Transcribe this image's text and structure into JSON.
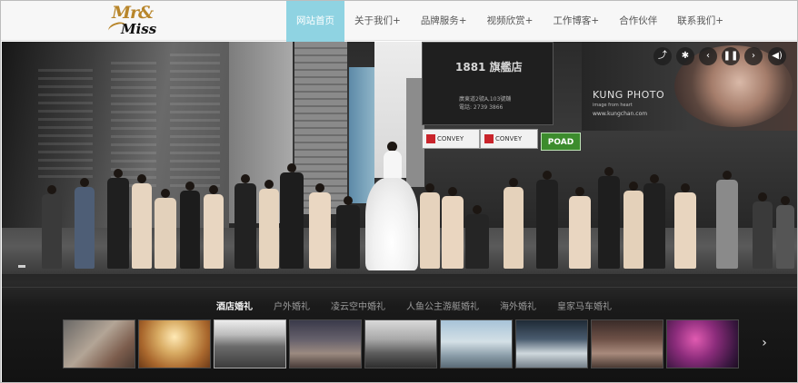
{
  "brand": {
    "logo_line1": "Mr&",
    "logo_line2": "Miss"
  },
  "nav": [
    {
      "label": "网站首页",
      "active": true
    },
    {
      "label": "关于我们+"
    },
    {
      "label": "品牌服务+"
    },
    {
      "label": "视频欣赏+"
    },
    {
      "label": "工作博客+"
    },
    {
      "label": "合作伙伴"
    },
    {
      "label": "联系我们+"
    }
  ],
  "hero": {
    "signs": {
      "sign_1881": "1881 旗艦店",
      "sign_1881_addr": "廣東道2號A,103號舖",
      "sign_1881_tel": "電話: 2739 3866",
      "kung_title": "KUNG PHOTO",
      "kung_tagline": "image from heart",
      "kung_url": "www.kungchan.com",
      "convey": "CONVEY",
      "poad": "POAD"
    },
    "controls": {
      "share_icon": "share-icon",
      "brightness_icon": "brightness-icon",
      "prev_icon": "prev-icon",
      "pause_icon": "pause-icon",
      "next_icon": "next-icon",
      "volume_icon": "volume-icon"
    }
  },
  "gallery": {
    "categories": [
      {
        "label": "酒店婚礼",
        "active": true
      },
      {
        "label": "户外婚礼"
      },
      {
        "label": "凌云空中婚礼"
      },
      {
        "label": "人鱼公主游艇婚礼"
      },
      {
        "label": "海外婚礼"
      },
      {
        "label": "皇家马车婚礼"
      }
    ],
    "thumb_count": 9,
    "next_glyph": "›"
  },
  "colors": {
    "nav_active": "#8fd3e2",
    "logo_gold": "#b8862b"
  }
}
